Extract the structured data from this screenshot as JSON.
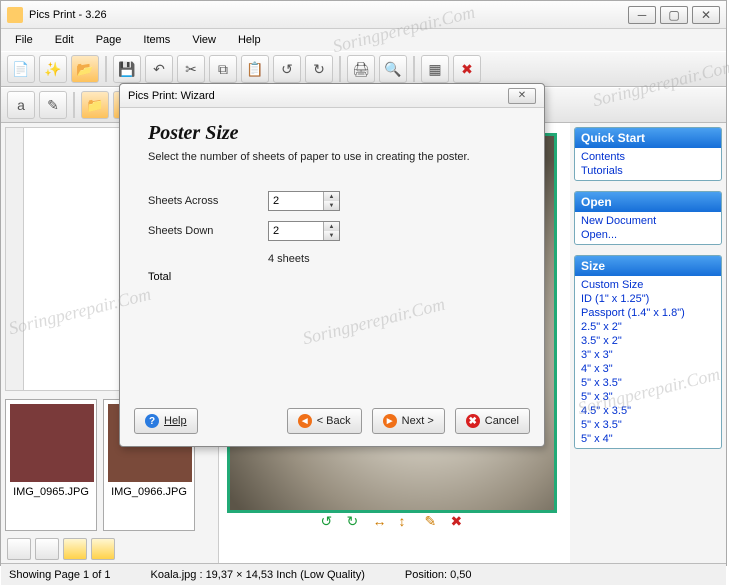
{
  "window": {
    "title": "Pics Print - 3.26"
  },
  "menu": {
    "file": "File",
    "edit": "Edit",
    "page": "Page",
    "items": "Items",
    "view": "View",
    "help": "Help"
  },
  "thumbs": [
    {
      "label": "IMG_0965.JPG"
    },
    {
      "label": "IMG_0966.JPG"
    }
  ],
  "panels": {
    "quickstart": {
      "title": "Quick Start",
      "links": [
        "Contents",
        "Tutorials"
      ]
    },
    "open": {
      "title": "Open",
      "links": [
        "New Document",
        "Open..."
      ]
    },
    "size": {
      "title": "Size",
      "links": [
        "Custom Size",
        "ID (1\" x 1.25\")",
        "Passport (1.4\" x 1.8\")",
        "2.5\" x 2\"",
        "3.5\" x 2\"",
        "3\" x 3\"",
        "4\" x 3\"",
        "5\" x 3.5\"",
        "5\" x 3\"",
        "4.5\" x 3.5\"",
        "5\" x 3.5\"",
        "5\" x 4\""
      ]
    }
  },
  "dialog": {
    "title": "Pics Print: Wizard",
    "heading": "Poster Size",
    "sub": "Select the number of sheets of paper to use in creating the poster.",
    "across_label": "Sheets Across",
    "down_label": "Sheets Down",
    "across_value": "2",
    "down_value": "2",
    "total_label": "Total",
    "total_value": "4 sheets",
    "help": "Help",
    "back": "< Back",
    "next": "Next >",
    "cancel": "Cancel"
  },
  "status": {
    "page": "Showing Page 1 of 1",
    "info": "Koala.jpg : 19,37 × 14,53 Inch (Low Quality)",
    "pos": "Position: 0,50"
  },
  "watermark": "Soringperepair.Com"
}
